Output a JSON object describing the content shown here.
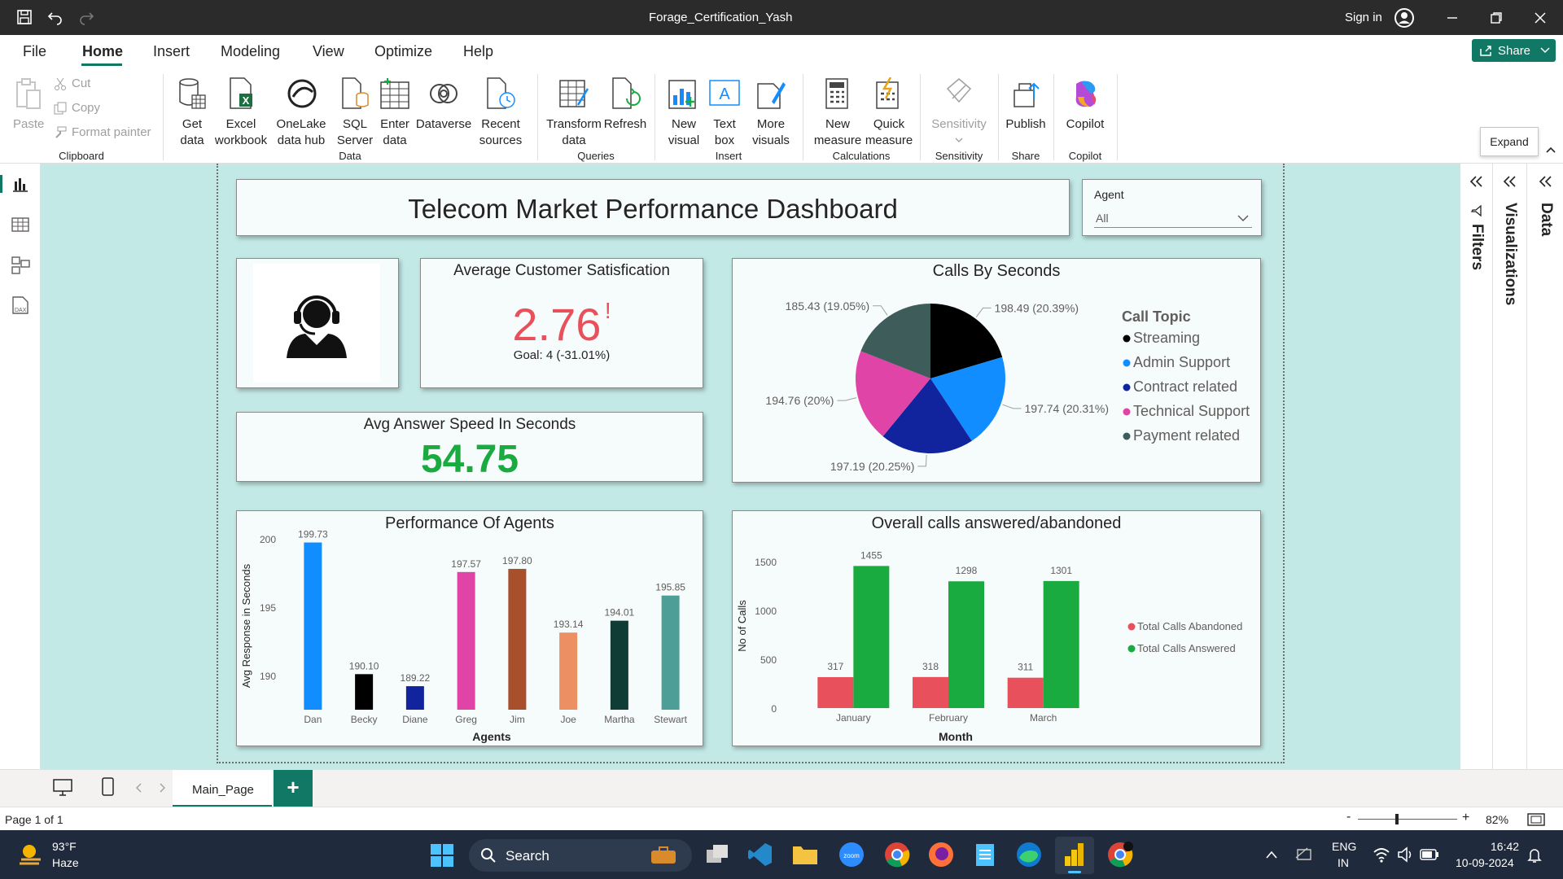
{
  "window": {
    "title": "Forage_Certification_Yash",
    "sign_in": "Sign in"
  },
  "menu": {
    "items": [
      "File",
      "Home",
      "Insert",
      "Modeling",
      "View",
      "Optimize",
      "Help"
    ],
    "share": "Share"
  },
  "ribbon": {
    "clipboard": {
      "paste": "Paste",
      "cut": "Cut",
      "copy": "Copy",
      "format_painter": "Format painter",
      "group": "Clipboard"
    },
    "data": {
      "get_data": [
        "Get",
        "data"
      ],
      "excel": [
        "Excel",
        "workbook"
      ],
      "onelake": [
        "OneLake",
        "data hub"
      ],
      "sql": [
        "SQL",
        "Server"
      ],
      "enter": [
        "Enter",
        "data"
      ],
      "dataverse": "Dataverse",
      "recent": [
        "Recent",
        "sources"
      ],
      "group": "Data"
    },
    "queries": {
      "transform": [
        "Transform",
        "data"
      ],
      "refresh": "Refresh",
      "group": "Queries"
    },
    "insert": {
      "new_visual": [
        "New",
        "visual"
      ],
      "text_box": [
        "Text",
        "box"
      ],
      "more_visuals": [
        "More",
        "visuals"
      ],
      "group": "Insert"
    },
    "calculations": {
      "new_measure": [
        "New",
        "measure"
      ],
      "quick_measure": [
        "Quick",
        "measure"
      ],
      "group": "Calculations"
    },
    "sensitivity": {
      "label": "Sensitivity",
      "group": "Sensitivity"
    },
    "share": {
      "publish": "Publish",
      "group": "Share"
    },
    "copilot": {
      "label": "Copilot",
      "group": "Copilot"
    },
    "expand_tooltip": "Expand"
  },
  "dashboard": {
    "title": "Telecom Market Performance Dashboard",
    "slicer": {
      "label": "Agent",
      "value": "All"
    },
    "csat": {
      "title": "Average Customer Satisfication",
      "value": "2.76",
      "alert": "!",
      "goal": "Goal: 4 (-31.01%)"
    },
    "speed": {
      "title": "Avg Answer Speed In Seconds",
      "value": "54.75"
    }
  },
  "panes": {
    "filters": "Filters",
    "visualizations": "Visualizations",
    "data": "Data"
  },
  "tabs": {
    "page": "Main_Page",
    "add": "+"
  },
  "status": {
    "page": "Page 1 of 1",
    "zoom": "82%",
    "zoom_minus": "-",
    "zoom_plus": "+"
  },
  "taskbar": {
    "temp": "93°F",
    "weather": "Haze",
    "search": "Search",
    "lang1": "ENG",
    "lang2": "IN",
    "time": "16:42",
    "date": "10-09-2024"
  },
  "colors": {
    "accent": "#117865",
    "red": "#e8505b",
    "green": "#1aab40",
    "canvas": "#c3e9e6"
  },
  "chart_data": [
    {
      "type": "pie",
      "title": "Calls By Seconds",
      "legend_title": "Call Topic",
      "legend_position": "right",
      "slices": [
        {
          "name": "Streaming",
          "value": 198.49,
          "label": "198.49 (20.39%)",
          "color": "#000000"
        },
        {
          "name": "Admin Support",
          "value": 197.74,
          "label": "197.74 (20.31%)",
          "color": "#118dff"
        },
        {
          "name": "Contract related",
          "value": 197.19,
          "label": "197.19 (20.25%)",
          "color": "#12239e"
        },
        {
          "name": "Technical Support",
          "value": 194.76,
          "label": "194.76 (20%)",
          "color": "#e044a7"
        },
        {
          "name": "Payment related",
          "value": 185.43,
          "label": "185.43 (19.05%)",
          "color": "#3d5c5a"
        }
      ]
    },
    {
      "type": "bar",
      "title": "Performance Of Agents",
      "xlabel": "Agents",
      "ylabel": "Avg Response in Seconds",
      "ylim": [
        187.5,
        200
      ],
      "yticks": [
        190,
        195,
        200
      ],
      "categories": [
        "Dan",
        "Becky",
        "Diane",
        "Greg",
        "Jim",
        "Joe",
        "Martha",
        "Stewart"
      ],
      "values": [
        199.73,
        190.1,
        189.22,
        197.57,
        197.8,
        193.14,
        194.01,
        195.85
      ],
      "labels": [
        "199.73",
        "190.10",
        "189.22",
        "197.57",
        "197.80",
        "193.14",
        "194.01",
        "195.85"
      ],
      "colors": [
        "#118dff",
        "#000000",
        "#12239e",
        "#e044a7",
        "#a8502c",
        "#ec8f62",
        "#0f3d36",
        "#4c9e96"
      ]
    },
    {
      "type": "bar",
      "title": "Overall calls answered/abandoned",
      "xlabel": "Month",
      "ylabel": "No of Calls",
      "ylim": [
        0,
        1500
      ],
      "yticks": [
        0,
        500,
        1000,
        1500
      ],
      "categories": [
        "January",
        "February",
        "March"
      ],
      "legend_position": "right",
      "series": [
        {
          "name": "Total Calls Abandoned",
          "values": [
            317,
            318,
            311
          ],
          "color": "#e8505b"
        },
        {
          "name": "Total Calls Answered",
          "values": [
            1455,
            1298,
            1301
          ],
          "color": "#1aab40"
        }
      ]
    }
  ]
}
